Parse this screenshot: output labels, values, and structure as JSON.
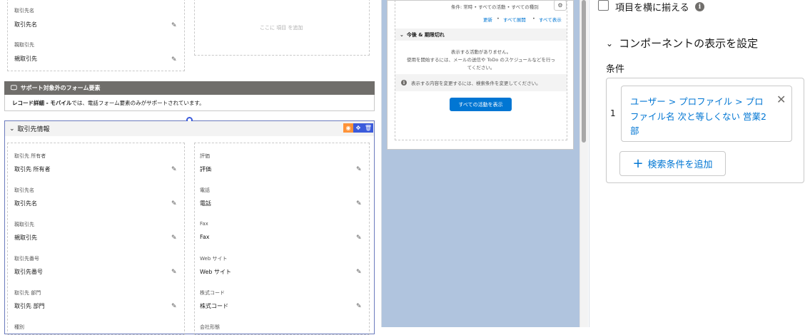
{
  "left": {
    "top_fields": [
      {
        "label": "取引先名",
        "value": "取引先名"
      },
      {
        "label": "親取引先",
        "value": "親取引先"
      }
    ],
    "drop_placeholder": "ここに 項目 を追加",
    "unsupported_banner": {
      "title": "サポート対象外のフォーム要素",
      "body_bold": "レコード詳細 - モバイル",
      "body_rest": "では、電話フォーム要素のみがサポートされています。"
    },
    "section": {
      "title": "取引先情報",
      "left_fields": [
        {
          "label": "取引先 所有者",
          "value": "取引先 所有者"
        },
        {
          "label": "取引先名",
          "value": "取引先名"
        },
        {
          "label": "親取引先",
          "value": "親取引先"
        },
        {
          "label": "取引先番号",
          "value": "取引先番号"
        },
        {
          "label": "取引先 部門",
          "value": "取引先 部門"
        },
        {
          "label": "種別",
          "value": ""
        }
      ],
      "right_fields": [
        {
          "label": "評価",
          "value": "評価"
        },
        {
          "label": "電話",
          "value": "電話"
        },
        {
          "label": "Fax",
          "value": "Fax"
        },
        {
          "label": "Web サイト",
          "value": "Web サイト"
        },
        {
          "label": "株式コード",
          "value": "株式コード"
        },
        {
          "label": "会社形態",
          "value": ""
        }
      ]
    }
  },
  "middle": {
    "filter_text": "条件: 常時 • すべての活動 • すべての種別",
    "links": {
      "refresh": "更新",
      "expand_all": "すべて展開",
      "show_all": "すべて表示"
    },
    "upcoming_title": "今後 & 期限切れ",
    "no_activity": "表示する活動がありません。",
    "hint_line1": "使用を開始するには、メールの送信や ToDo のスケジュールなどを行っ",
    "hint_line2": "てください。",
    "info_text": "表示する内容を変更するには、検索条件を変更してください。",
    "show_all_button": "すべての活動を表示"
  },
  "right": {
    "align_checkbox_label": "項目を横に揃える",
    "visibility_title": "コンポーネントの表示を設定",
    "conditions_label": "条件",
    "condition": {
      "index": "1",
      "line1": "ユーザー > プロファイル > プロ",
      "line2": "ファイル名 次と等しくない 営業2",
      "line3": "部"
    },
    "add_filter_button": "検索条件を追加"
  },
  "colors": {
    "accent": "#0176d3",
    "banner": "#706e6b",
    "canvas_bg": "#b0c4de",
    "tool_orange": "#fe9339",
    "tool_blue": "#3b5bdb"
  }
}
